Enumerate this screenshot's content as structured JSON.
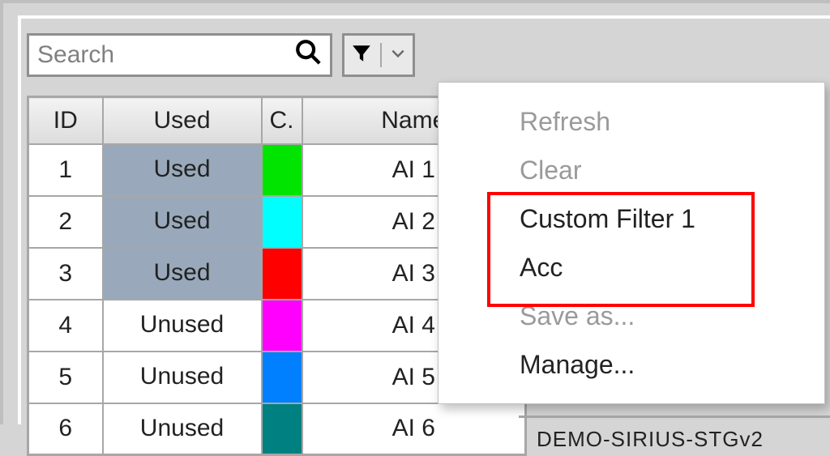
{
  "search": {
    "placeholder": "Search"
  },
  "table": {
    "headers": {
      "id": "ID",
      "used": "Used",
      "c": "C.",
      "name": "Name"
    },
    "rows": [
      {
        "id": "1",
        "used": "Used",
        "used_flag": true,
        "color": "#00e400",
        "name": "AI 1"
      },
      {
        "id": "2",
        "used": "Used",
        "used_flag": true,
        "color": "#00ffff",
        "name": "AI 2"
      },
      {
        "id": "3",
        "used": "Used",
        "used_flag": true,
        "color": "#ff0000",
        "name": "AI 3"
      },
      {
        "id": "4",
        "used": "Unused",
        "used_flag": false,
        "color": "#ff00ff",
        "name": "AI 4"
      },
      {
        "id": "5",
        "used": "Unused",
        "used_flag": false,
        "color": "#0080ff",
        "name": "AI 5"
      },
      {
        "id": "6",
        "used": "Unused",
        "used_flag": false,
        "color": "#008080",
        "name": "AI 6"
      }
    ]
  },
  "menu": {
    "refresh": "Refresh",
    "clear": "Clear",
    "custom1": "Custom Filter 1",
    "acc": "Acc",
    "saveas": "Save as...",
    "manage": "Manage..."
  },
  "peek_text": "DEMO-SIRIUS-STGv2"
}
